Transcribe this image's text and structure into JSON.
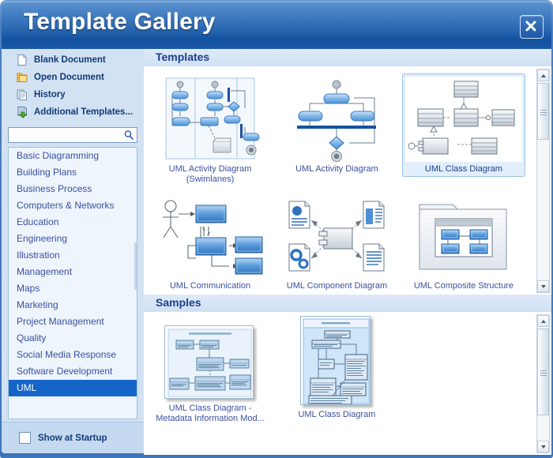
{
  "window": {
    "title": "Template Gallery",
    "close_label": "Close"
  },
  "sidebar": {
    "quick_links": [
      {
        "label": "Blank Document",
        "icon": "blank-document-icon"
      },
      {
        "label": "Open Document",
        "icon": "open-folder-icon"
      },
      {
        "label": "History",
        "icon": "history-documents-icon"
      },
      {
        "label": "Additional Templates...",
        "icon": "download-templates-icon"
      }
    ],
    "search": {
      "value": "",
      "placeholder": "",
      "icon": "search-icon"
    },
    "categories": [
      "Basic Diagramming",
      "Building Plans",
      "Business Process",
      "Computers & Networks",
      "Education",
      "Engineering",
      "Illustration",
      "Management",
      "Maps",
      "Marketing",
      "Project Management",
      "Quality",
      "Social Media Response",
      "Software Development",
      "UML"
    ],
    "selected_category": "UML",
    "startup": {
      "label": "Show at Startup",
      "checked": false
    }
  },
  "templates_section": {
    "header": "Templates",
    "items": [
      {
        "label": "UML Activity Diagram (Swimlanes)",
        "thumb": "activity-swimlanes-thumb",
        "selected": false
      },
      {
        "label": "UML Activity Diagram",
        "thumb": "activity-diagram-thumb",
        "selected": false
      },
      {
        "label": "UML Class Diagram",
        "thumb": "class-diagram-thumb",
        "selected": true
      },
      {
        "label": "UML Communication",
        "thumb": "communication-thumb",
        "selected": false
      },
      {
        "label": "UML Component Diagram",
        "thumb": "component-thumb",
        "selected": false
      },
      {
        "label": "UML Composite Structure",
        "thumb": "composite-structure-thumb",
        "selected": false
      }
    ]
  },
  "samples_section": {
    "header": "Samples",
    "items": [
      {
        "label": "UML Class Diagram - Metadata Information Mod...",
        "thumb": "sample-metadata-thumb"
      },
      {
        "label": "UML Class Diagram",
        "thumb": "sample-class-thumb"
      }
    ]
  },
  "colors": {
    "title_bar": "#1d5aa7",
    "selection": "#1565c8",
    "sidebar": "#d2e2f3",
    "link_text": "#3b4fa0",
    "header_text": "#1b3e8c"
  }
}
